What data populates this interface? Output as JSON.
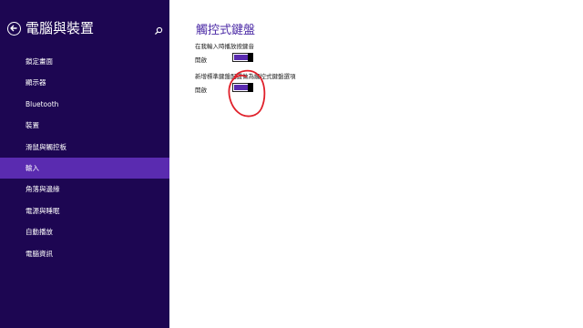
{
  "sidebar": {
    "title": "電腦與裝置",
    "back_icon": "back-arrow-icon",
    "search_icon": "search-icon",
    "items": [
      {
        "label": "鎖定畫面",
        "selected": false
      },
      {
        "label": "顯示器",
        "selected": false
      },
      {
        "label": "Bluetooth",
        "selected": false
      },
      {
        "label": "裝置",
        "selected": false
      },
      {
        "label": "滑鼠與觸控板",
        "selected": false
      },
      {
        "label": "輸入",
        "selected": true
      },
      {
        "label": "角落與邊緣",
        "selected": false
      },
      {
        "label": "電源與睡眠",
        "selected": false
      },
      {
        "label": "自動播放",
        "selected": false
      },
      {
        "label": "電腦資訊",
        "selected": false
      }
    ]
  },
  "main": {
    "title": "觸控式鍵盤",
    "settings": [
      {
        "label": "在我輸入時播放按鍵音",
        "state": "開啟",
        "on": true
      },
      {
        "label": "新增標準鍵盤配置做為觸控式鍵盤選項",
        "state": "開啟",
        "on": true
      }
    ]
  },
  "colors": {
    "sidebar_bg": "#1d0652",
    "selected_bg": "#5a2bb0",
    "accent": "#4c2ba6",
    "annotation": "#e0202a"
  }
}
